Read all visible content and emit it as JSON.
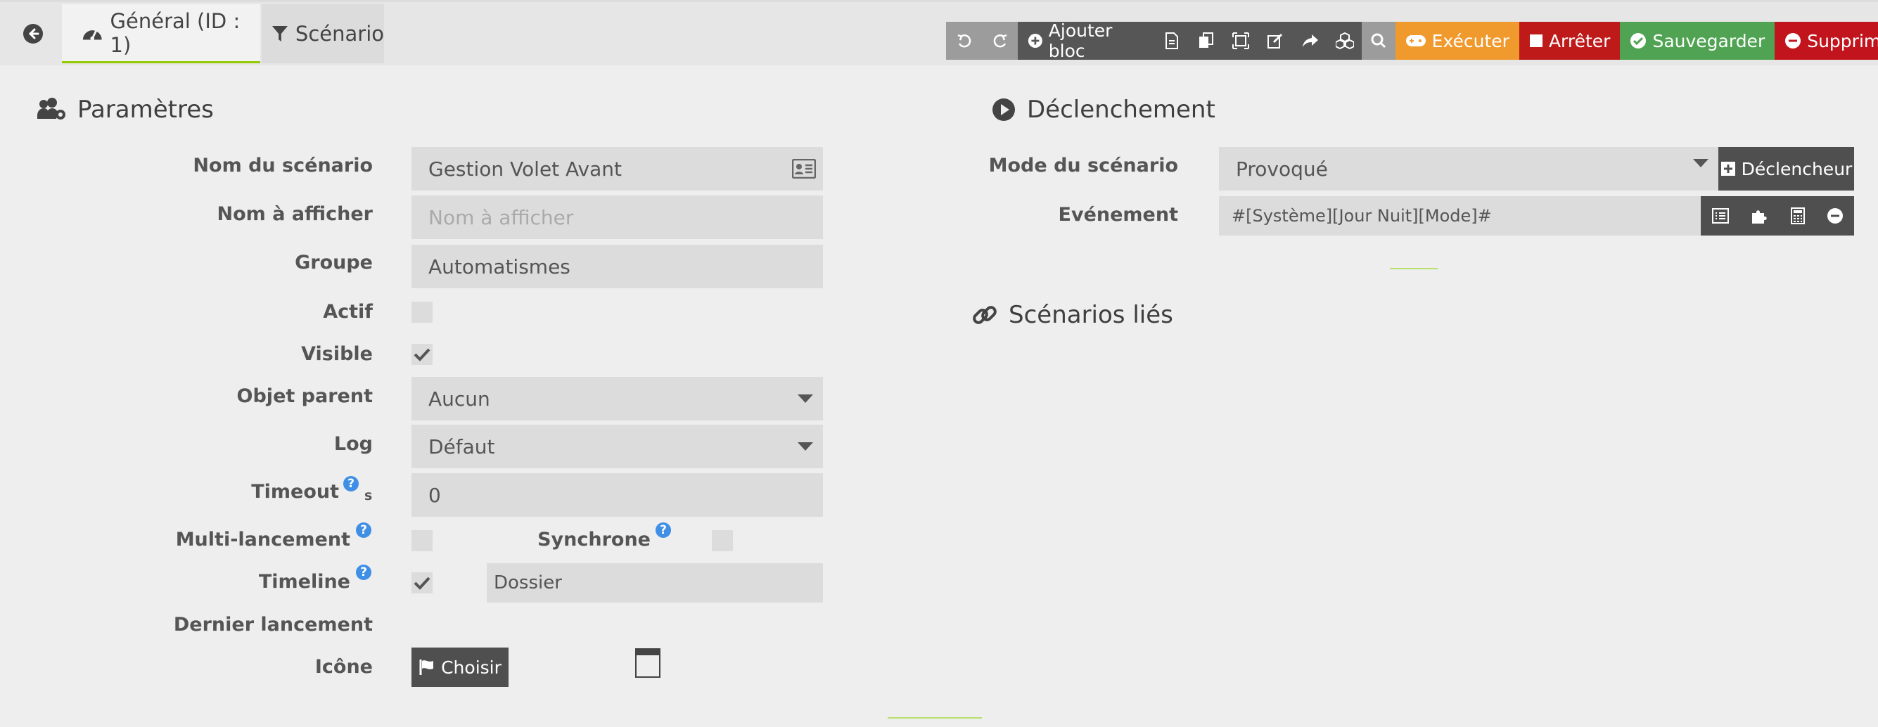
{
  "tabs": {
    "general": "Général (ID : 1)",
    "scenario": "Scénario"
  },
  "toolbar": {
    "add_block": "Ajouter bloc",
    "execute": "Exécuter",
    "stop": "Arrêter",
    "save": "Sauvegarder",
    "delete": "Supprimer"
  },
  "params": {
    "title": "Paramètres",
    "name_label": "Nom du scénario",
    "name_value": "Gestion Volet Avant",
    "display_label": "Nom à afficher",
    "display_placeholder": "Nom à afficher",
    "group_label": "Groupe",
    "group_value": "Automatismes",
    "active_label": "Actif",
    "visible_label": "Visible",
    "parent_label": "Objet parent",
    "parent_value": "Aucun",
    "log_label": "Log",
    "log_value": "Défaut",
    "timeout_label": "Timeout",
    "timeout_unit": "s",
    "timeout_value": "0",
    "multi_label": "Multi-lancement",
    "sync_label": "Synchrone",
    "timeline_label": "Timeline",
    "timeline_value": "Dossier",
    "last_run_label": "Dernier lancement",
    "icon_label": "Icône",
    "choose_button": "Choisir"
  },
  "trigger": {
    "title": "Déclenchement",
    "mode_label": "Mode du scénario",
    "mode_value": "Provoqué",
    "trigger_button": "Déclencheur",
    "event_label": "Evénement",
    "event_value": "#[Système][Jour Nuit][Mode]#"
  },
  "linked": {
    "title": "Scénarios liés"
  },
  "colors": {
    "accent": "#94ca02",
    "execute": "#f0992d",
    "stop": "#be1a1a",
    "save": "#4fa352",
    "delete": "#c1141c"
  }
}
